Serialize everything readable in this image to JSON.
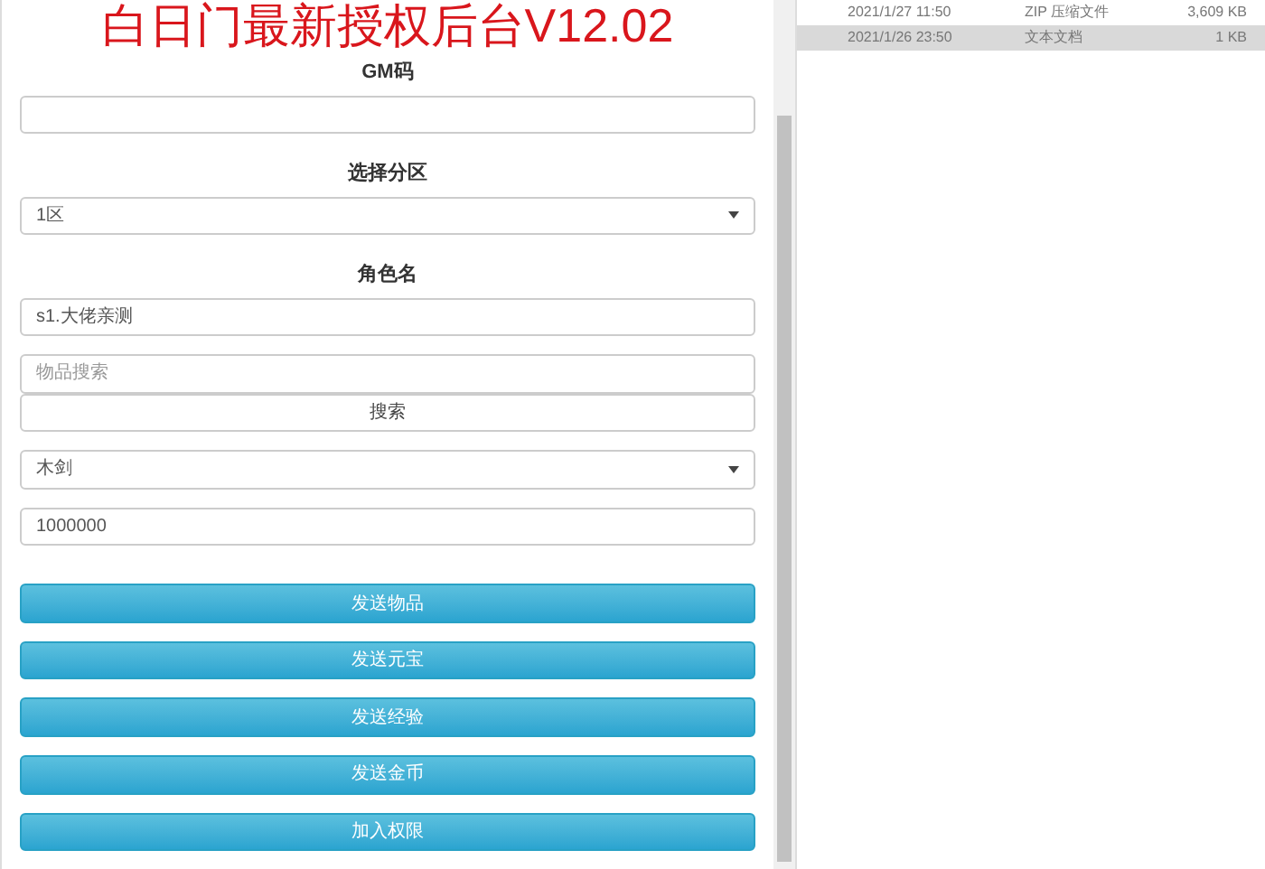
{
  "title": "白日门最新授权后台V12.02",
  "form": [
    {
      "kind": "label",
      "text": "GM码"
    },
    {
      "kind": "input"
    },
    {
      "kind": "label",
      "text": "选择分区"
    },
    {
      "kind": "select",
      "value": "1区"
    },
    {
      "kind": "label",
      "text": "角色名"
    },
    {
      "kind": "input",
      "value": "s1.大佬亲测"
    },
    {
      "kind": "input",
      "placeholder": "物品搜索"
    },
    {
      "kind": "plainbutton",
      "text": "搜索"
    },
    {
      "kind": "select",
      "value": "木剑"
    },
    {
      "kind": "input",
      "value": "1000000"
    }
  ],
  "actions": [
    "发送物品",
    "发送元宝",
    "发送经验",
    "发送金币",
    "加入权限"
  ],
  "files": [
    {
      "date": "2021/1/27 11:50",
      "type": "ZIP 压缩文件",
      "size": "3,609 KB",
      "selected": false
    },
    {
      "date": "2021/1/26 23:50",
      "type": "文本文档",
      "size": "1 KB",
      "selected": true
    }
  ]
}
